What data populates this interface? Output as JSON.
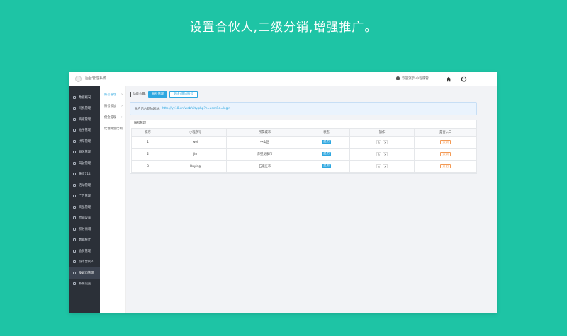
{
  "banner": {
    "text": "设置合伙人,二级分销,增强推广。"
  },
  "app": {
    "title": "后台管理系统",
    "user": "欢迎演示-小程序管..."
  },
  "sidebar": {
    "items": [
      {
        "label": "数据概况",
        "icon": "chart-icon"
      },
      {
        "label": "司机管理",
        "icon": "user-icon"
      },
      {
        "label": "商家管理",
        "icon": "shop-icon"
      },
      {
        "label": "帖子管理",
        "icon": "post-icon"
      },
      {
        "label": "拼车管理",
        "icon": "car-icon"
      },
      {
        "label": "顺风管理",
        "icon": "car-icon"
      },
      {
        "label": "驾驶管理",
        "icon": "wheel-icon"
      },
      {
        "label": "黄页114",
        "icon": "book-icon"
      },
      {
        "label": "活动管理",
        "icon": "activity-icon"
      },
      {
        "label": "广告管理",
        "icon": "ad-icon"
      },
      {
        "label": "商品管理",
        "icon": "cart-icon"
      },
      {
        "label": "营销设置",
        "icon": "marketing-icon"
      },
      {
        "label": "积分商城",
        "icon": "points-icon"
      },
      {
        "label": "数据统计",
        "icon": "stats-icon"
      },
      {
        "label": "会员管理",
        "icon": "member-icon"
      },
      {
        "label": "城市合伙人",
        "icon": "partner-icon"
      },
      {
        "label": "多城市管理",
        "icon": "city-icon"
      },
      {
        "label": "系统设置",
        "icon": "gear-icon"
      }
    ],
    "active_index": 16
  },
  "subnav": {
    "items": [
      {
        "label": "账号管理",
        "active": true
      },
      {
        "label": "账号添加",
        "active": false
      },
      {
        "label": "佣金提现",
        "active": false
      },
      {
        "label": "代理佣金比例",
        "active": false
      }
    ]
  },
  "toolbar": {
    "label": "功能位置:",
    "btn_primary": "账号管理",
    "btn_secondary": "佣金/增加账号"
  },
  "info": {
    "label": "账户后台登陆网址:",
    "url": "http://yy18.cn/web/city.php?c=user&a=login"
  },
  "panel": {
    "title": "账号管理"
  },
  "table": {
    "headers": [
      "排序",
      "小程序号",
      "所属城市",
      "状态",
      "操作",
      "是否入口"
    ],
    "rows": [
      {
        "order": "1",
        "account": "wei",
        "city": "中山区",
        "status": "启用",
        "entry": "关闭"
      },
      {
        "order": "2",
        "account": "jin",
        "city": "赤壁龙泉市",
        "status": "启用",
        "entry": "关闭"
      },
      {
        "order": "3",
        "account": "Buying",
        "city": "石家庄市",
        "status": "启用",
        "entry": "开启"
      }
    ]
  }
}
